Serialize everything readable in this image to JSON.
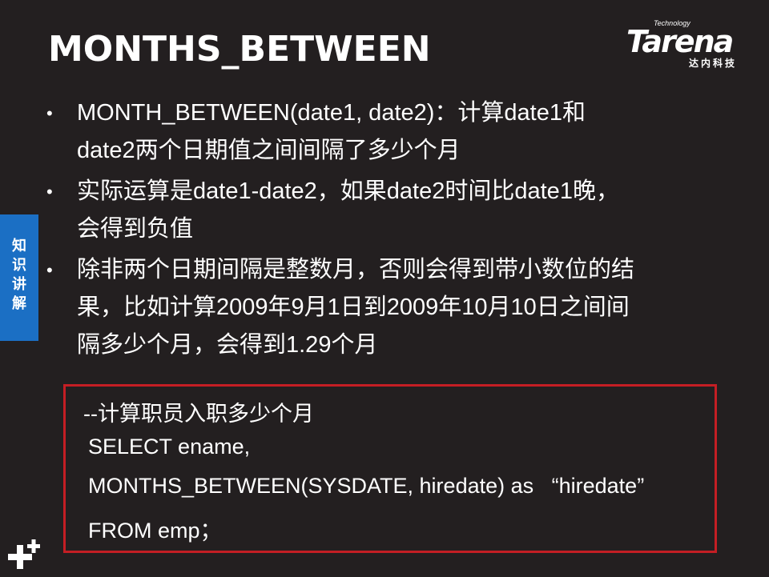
{
  "title": "MONTHS_BETWEEN",
  "logo": {
    "top": "Technology",
    "main": "Tarena",
    "sub": "达内科技"
  },
  "side_tab": [
    "知",
    "识",
    "讲",
    "解"
  ],
  "bullets": [
    {
      "marker": "•",
      "lines": [
        "MONTH_BETWEEN(date1, date2)：计算date1和",
        "date2两个日期值之间间隔了多少个月"
      ]
    },
    {
      "marker": "•",
      "lines": [
        "实际运算是date1-date2，如果date2时间比date1晚，",
        "会得到负值"
      ]
    },
    {
      "marker": "•",
      "lines": [
        "除非两个日期间隔是整数月，否则会得到带小数位的结",
        "果，比如计算2009年9月1日到2009年10月10日之间间",
        "隔多少个月，会得到1.29个月"
      ]
    }
  ],
  "code": {
    "lines": [
      "--计算职员入职多少个月",
      "SELECT ename,",
      "MONTHS_BETWEEN(SYSDATE, hiredate) as   “hiredate”",
      "FROM emp；"
    ]
  },
  "colors": {
    "background": "#231f20",
    "side_tab": "#1b6fc4",
    "code_border": "#c41e24",
    "text": "#ffffff"
  },
  "icons": {
    "corner": "plus-icon"
  }
}
